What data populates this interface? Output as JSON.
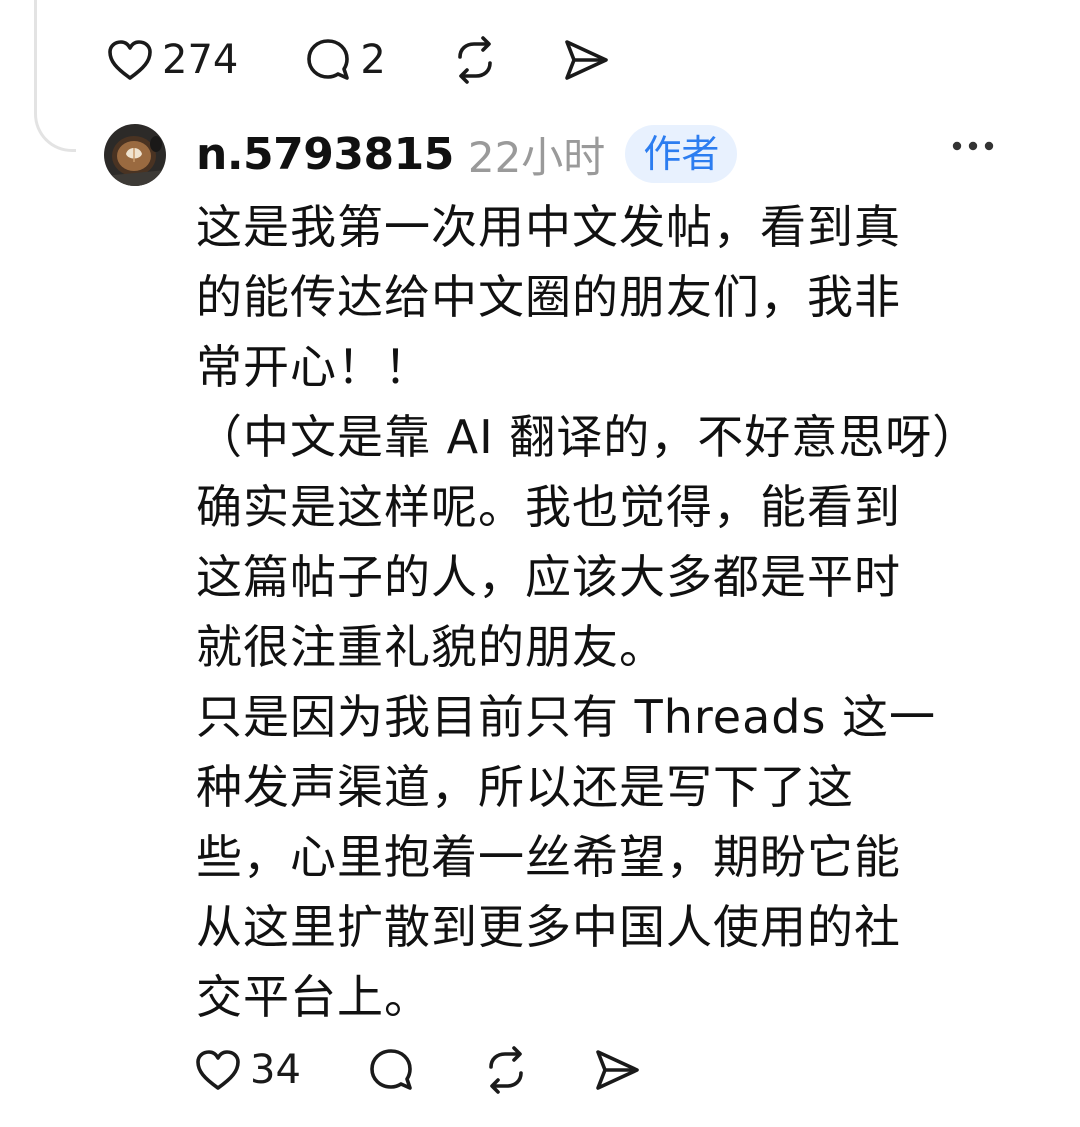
{
  "parent_post": {
    "likes": "274",
    "replies": "2"
  },
  "reply": {
    "username": "n.5793815",
    "time": "22小时",
    "badge": "作者",
    "paragraphs": [
      "这是我第一次用中文发帖，看到真\n的能传达给中文圈的朋友们，我非\n常开心！！",
      "（中文是靠 AI 翻译的，不好意思呀）",
      "确实是这样呢。我也觉得，能看到\n这篇帖子的人，应该大多都是平时\n就很注重礼貌的朋友。",
      "只是因为我目前只有 Threads 这一\n种发声渠道，所以还是写下了这\n些，心里抱着一丝希望，期盼它能\n从这里扩散到更多中国人使用的社\n交平台上。"
    ],
    "likes": "34"
  },
  "icons": {
    "like": "heart-icon",
    "reply": "comment-icon",
    "repost": "repost-icon",
    "share": "send-icon",
    "more": "more-icon"
  }
}
